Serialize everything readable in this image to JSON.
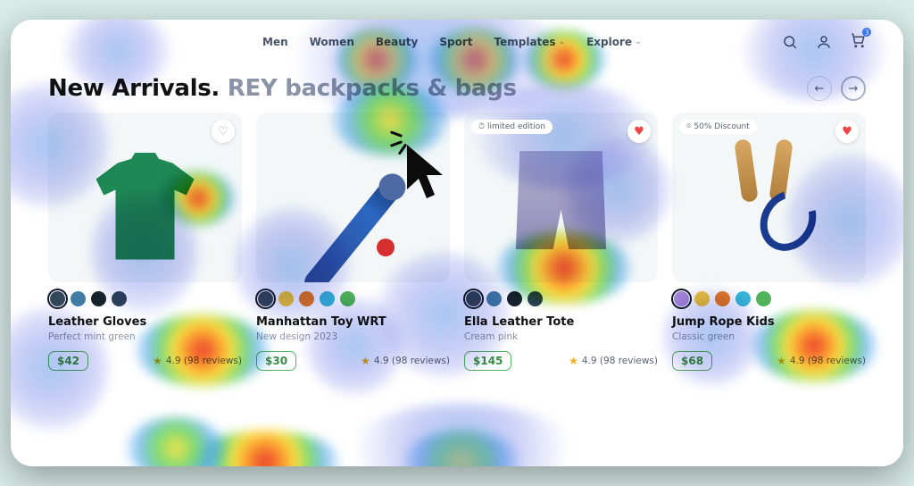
{
  "nav": {
    "items": [
      "Men",
      "Women",
      "Beauty",
      "Sport",
      "Templates",
      "Explore"
    ],
    "cart_count": "3"
  },
  "hero": {
    "title_a": "New Arrivals.",
    "title_b": "REY backpacks & bags"
  },
  "rating_text": "4.9 (98 reviews)",
  "products": [
    {
      "name": "Leather Gloves",
      "sub": "Perfect mint green",
      "price": "$42",
      "badge": "",
      "fav": false,
      "swatches": [
        "sel c-navy",
        "c-blue",
        "c-dark",
        "c-navy2"
      ]
    },
    {
      "name": "Manhattan Toy WRT",
      "sub": "New design 2023",
      "price": "$30",
      "badge": "",
      "fav": false,
      "swatches": [
        "sel c-navy",
        "c-yellow",
        "c-orange",
        "c-teal",
        "c-green"
      ]
    },
    {
      "name": "Ella Leather Tote",
      "sub": "Cream pink",
      "price": "$145",
      "badge": "limited edition",
      "fav": true,
      "swatches": [
        "sel c-navy",
        "c-blue",
        "c-dark",
        "c-navy2"
      ]
    },
    {
      "name": "Jump Rope Kids",
      "sub": "Classic green",
      "price": "$68",
      "badge": "50% Discount",
      "fav": true,
      "swatches": [
        "sel c-purple",
        "c-yellow",
        "c-orange",
        "c-teal",
        "c-green"
      ]
    }
  ]
}
